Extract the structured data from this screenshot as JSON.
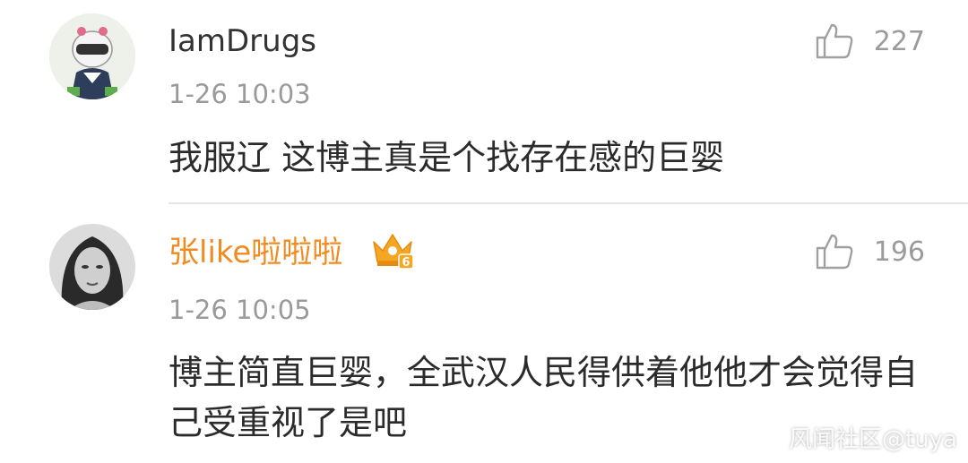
{
  "comments": [
    {
      "username": "IamDrugs",
      "time": "1-26 10:03",
      "likes": "227",
      "text": "我服辽 这博主真是个找存在感的巨婴"
    },
    {
      "username": "张like啦啦啦",
      "time": "1-26 10:05",
      "likes": "196",
      "text": "博主简直巨婴，全武汉人民得供着他他才会觉得自己受重视了是吧",
      "badge_level": "6"
    }
  ],
  "watermark": "风闻社区@tuya",
  "colors": {
    "vip_username": "#f28a1f",
    "crown": "#f5a623",
    "meta_text": "#9a9a9a"
  },
  "icons": [
    "like-thumb-icon",
    "vip-crown-icon"
  ]
}
